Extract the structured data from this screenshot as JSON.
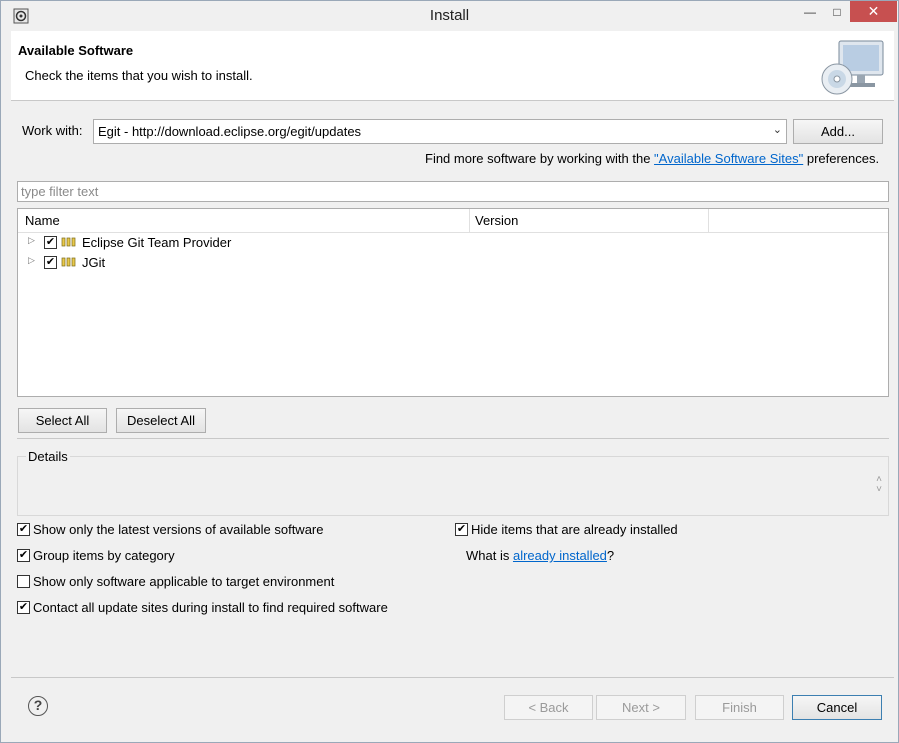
{
  "window": {
    "title": "Install",
    "minimize_glyph": "—",
    "maximize_glyph": "□",
    "close_glyph": "✕"
  },
  "banner": {
    "title": "Available Software",
    "subtitle": "Check the items that you wish to install."
  },
  "work_with": {
    "label": "Work with:",
    "value": "Egit - http://download.eclipse.org/egit/updates",
    "add_label": "Add..."
  },
  "find_more": {
    "prefix": "Find more software by working with the ",
    "link": "\"Available Software Sites\"",
    "suffix": " preferences."
  },
  "filter": {
    "placeholder": "type filter text"
  },
  "table": {
    "columns": [
      "Name",
      "Version"
    ],
    "rows": [
      {
        "name": "Eclipse Git Team Provider",
        "version": "",
        "checked": true
      },
      {
        "name": "JGit",
        "version": "",
        "checked": true
      }
    ]
  },
  "buttons": {
    "select_all": "Select All",
    "deselect_all": "Deselect All"
  },
  "details": {
    "label": "Details"
  },
  "options": {
    "latest_versions": {
      "label": "Show only the latest versions of available software",
      "checked": true
    },
    "group_by_category": {
      "label": "Group items by category",
      "checked": true
    },
    "applicable_target": {
      "label": "Show only software applicable to target environment",
      "checked": false
    },
    "contact_sites": {
      "label": "Contact all update sites during install to find required software",
      "checked": true
    },
    "hide_installed": {
      "label": "Hide items that are already installed",
      "checked": true
    },
    "what_is_prefix": "What is ",
    "what_is_link": "already installed",
    "what_is_suffix": "?"
  },
  "footer": {
    "help_glyph": "?",
    "back": "< Back",
    "next": "Next >",
    "finish": "Finish",
    "cancel": "Cancel"
  },
  "check_glyph": "✔",
  "colors": {
    "link": "#0066cc",
    "close_button": "#c75050",
    "window_bg": "#f0f0f0"
  }
}
